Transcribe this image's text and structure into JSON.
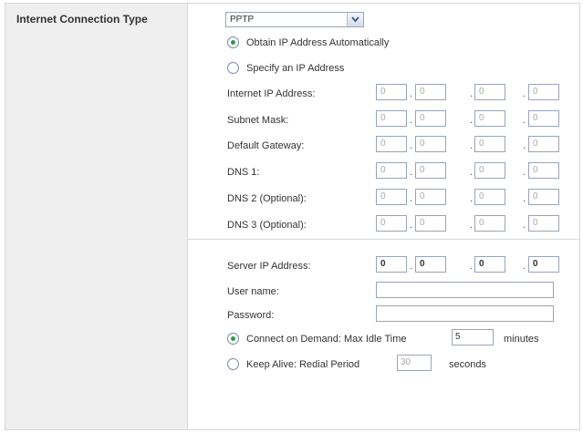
{
  "section_title": "Internet Connection Type",
  "connection_type": {
    "selected": "PPTP"
  },
  "ip_mode": {
    "auto_label": "Obtain IP Address Automatically",
    "static_label": "Specify an IP Address"
  },
  "static_fields": [
    {
      "label": "Internet IP Address:",
      "octets": [
        "0",
        "0",
        "0",
        "0"
      ]
    },
    {
      "label": "Subnet Mask:",
      "octets": [
        "0",
        "0",
        "0",
        "0"
      ]
    },
    {
      "label": "Default Gateway:",
      "octets": [
        "0",
        "0",
        "0",
        "0"
      ]
    },
    {
      "label": "DNS 1:",
      "octets": [
        "0",
        "0",
        "0",
        "0"
      ]
    },
    {
      "label": "DNS 2 (Optional):",
      "octets": [
        "0",
        "0",
        "0",
        "0"
      ]
    },
    {
      "label": "DNS 3 (Optional):",
      "octets": [
        "0",
        "0",
        "0",
        "0"
      ]
    }
  ],
  "server": {
    "label": "Server IP Address:",
    "octets": [
      "0",
      "0",
      "0",
      "0"
    ]
  },
  "username": {
    "label": "User name:",
    "value": ""
  },
  "password": {
    "label": "Password:",
    "value": ""
  },
  "connect_on_demand": {
    "label": "Connect on Demand: Max Idle Time",
    "value": "5",
    "unit": "minutes"
  },
  "keep_alive": {
    "label": "Keep Alive: Redial Period",
    "value": "30",
    "unit": "seconds"
  },
  "colors": {
    "sidebar_bg": "#efefef",
    "radio_checked": "#2e9a4a",
    "input_border": "#9aa4b4"
  }
}
